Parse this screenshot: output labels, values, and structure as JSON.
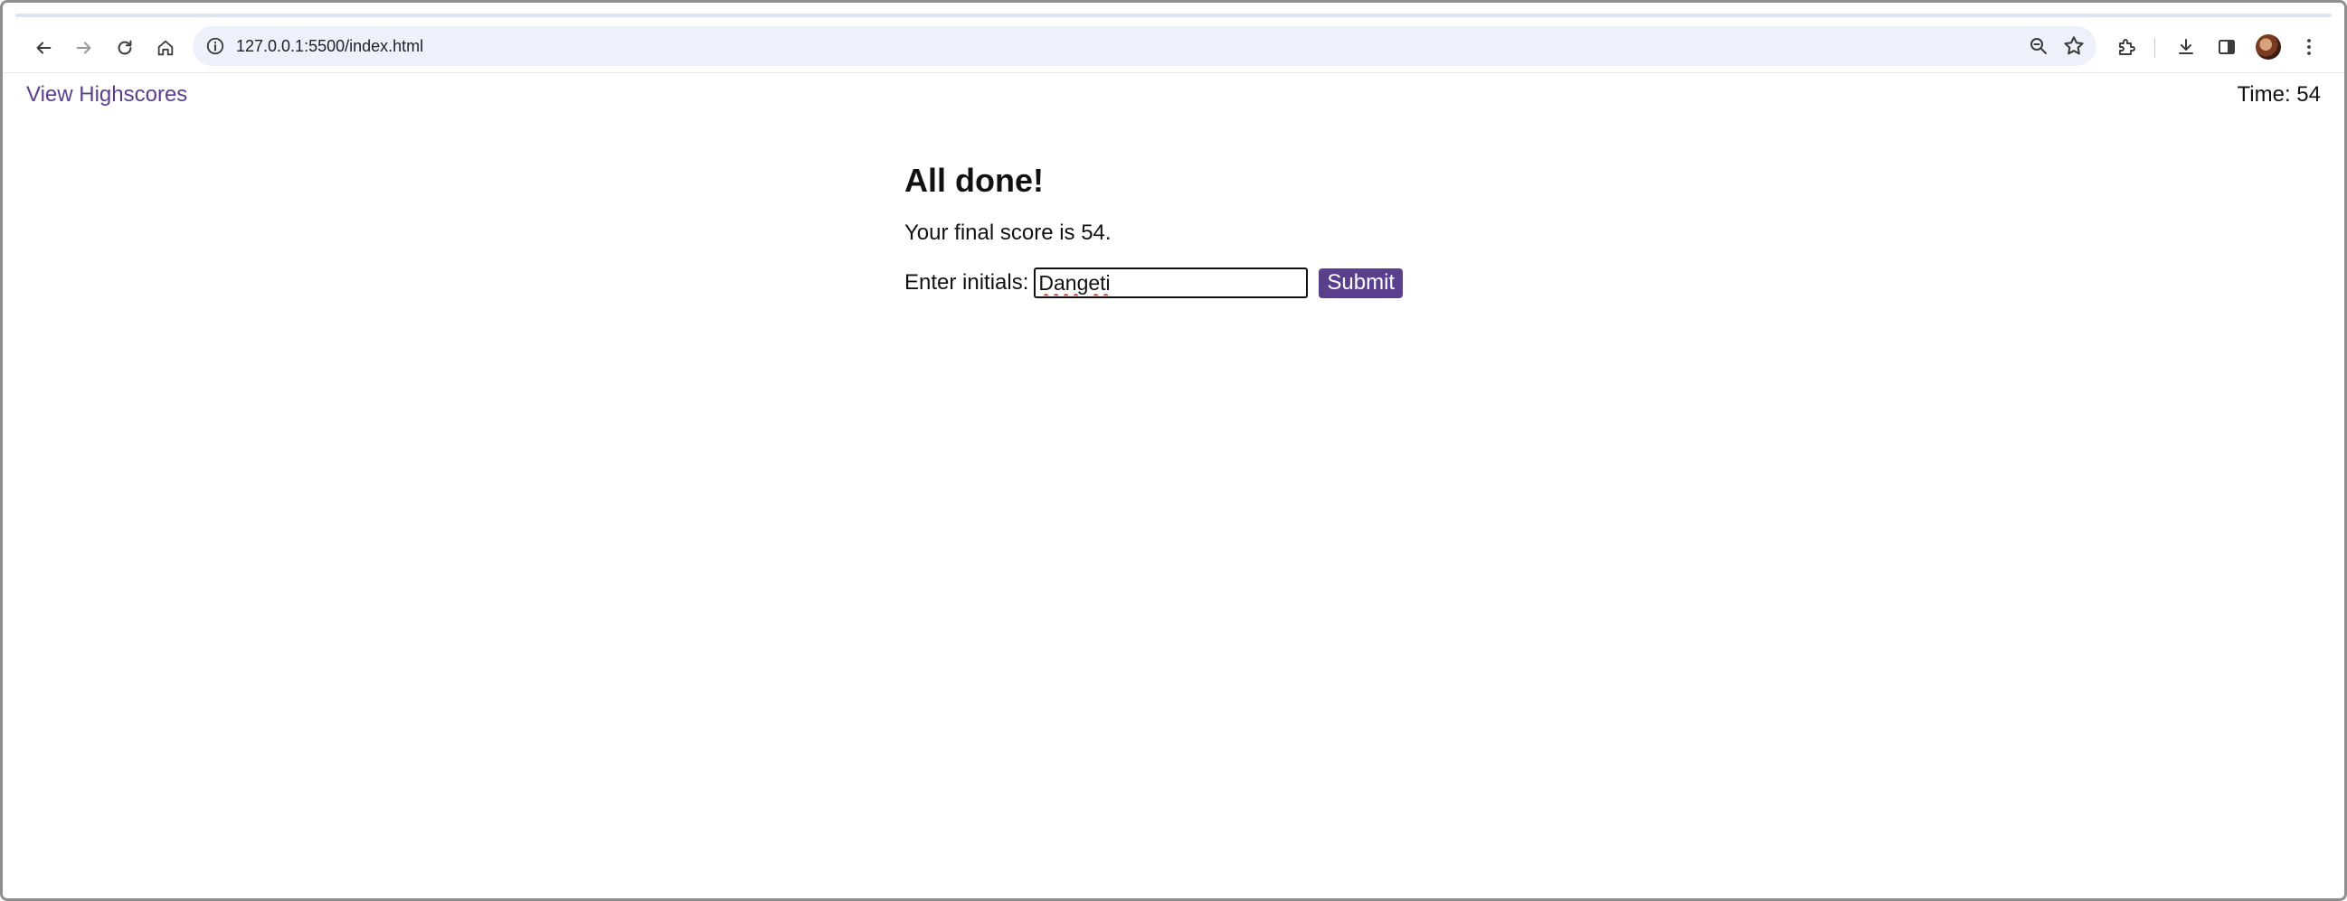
{
  "browser": {
    "url": "127.0.0.1:5500/index.html",
    "icons": {
      "back": "arrow-left-icon",
      "forward": "arrow-right-icon",
      "reload": "reload-icon",
      "home": "home-icon",
      "site_info": "info-icon",
      "zoom": "zoom-icon",
      "bookmark": "star-icon",
      "extensions": "puzzle-icon",
      "downloads": "download-icon",
      "side_panel": "side-panel-icon",
      "profile": "avatar",
      "menu": "kebab-menu-icon"
    }
  },
  "header": {
    "highscores_link": "View Highscores",
    "timer": "Time: 54"
  },
  "main": {
    "title": "All done!",
    "score_text": "Your final score is 54.",
    "initials_label": "Enter initials:",
    "initials_value": "Dangeti",
    "submit_label": "Submit"
  },
  "colors": {
    "accent": "#5a3f8e",
    "omnibox_bg": "#eef1f9",
    "text": "#111111"
  }
}
